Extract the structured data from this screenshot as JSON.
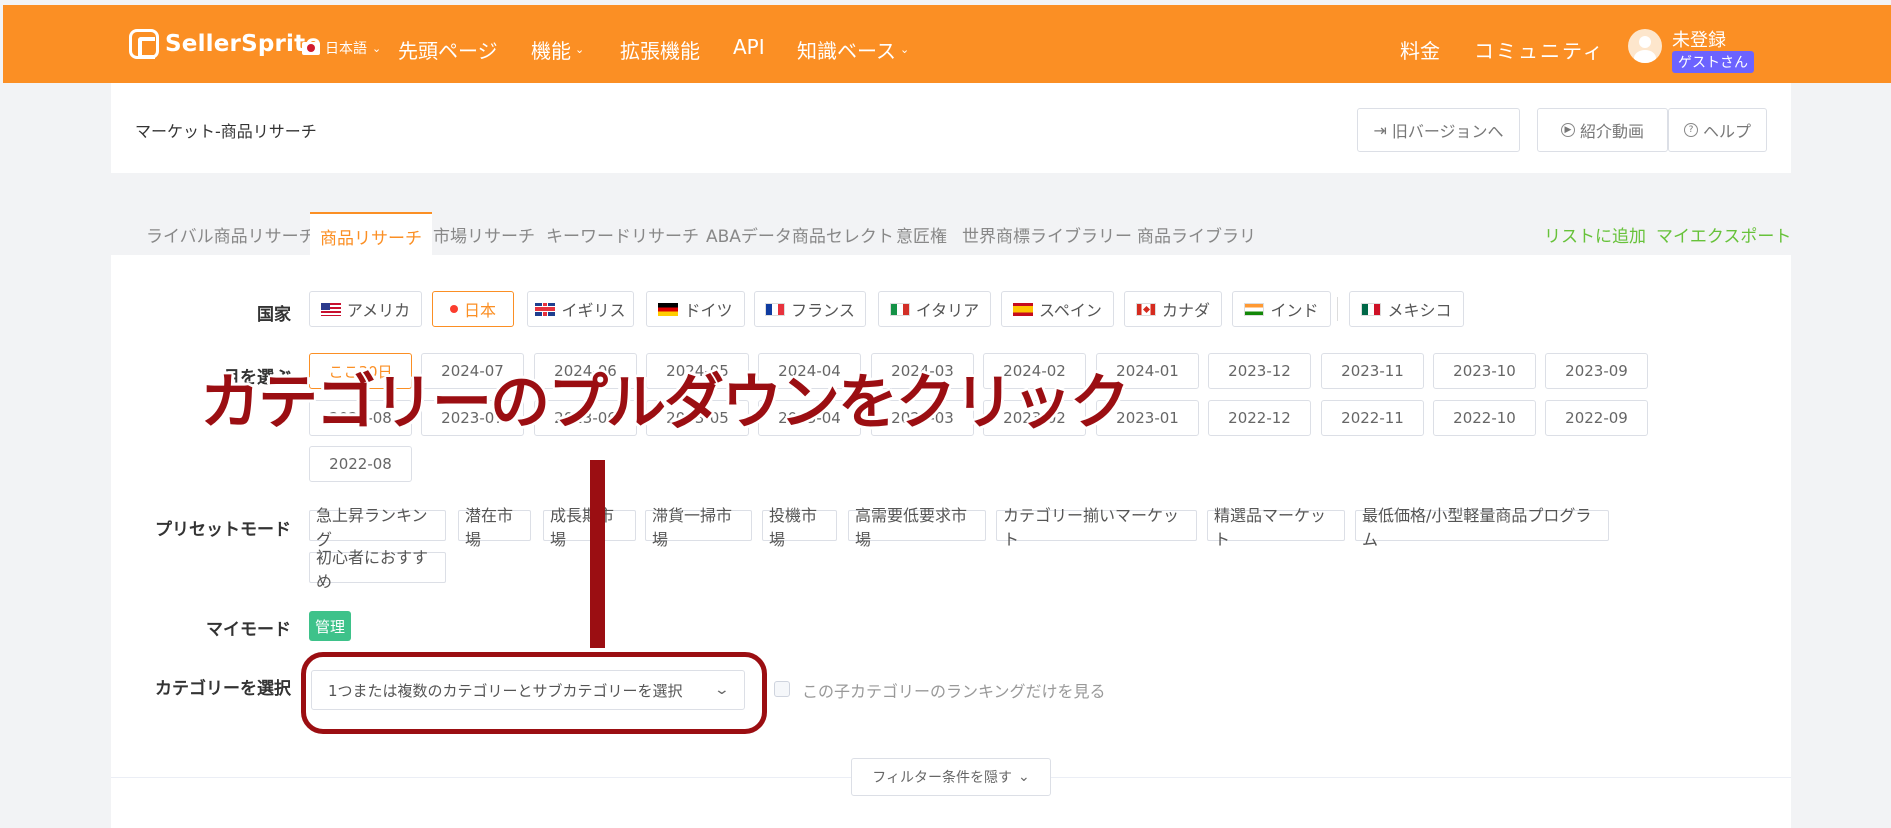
{
  "nav": {
    "brand": "SellerSprite",
    "language": "日本語",
    "items": [
      {
        "label": "先頭ページ",
        "caret": false
      },
      {
        "label": "機能",
        "caret": true
      },
      {
        "label": "拡張機能",
        "caret": false
      },
      {
        "label": "API",
        "caret": false
      },
      {
        "label": "知識ベース",
        "caret": true
      }
    ],
    "right": {
      "pricing": "料金",
      "community": "コミュニティ"
    },
    "user": {
      "name": "未登録",
      "badge": "ゲストさん"
    }
  },
  "header": {
    "title": "マーケット-商品リサーチ",
    "buttons": {
      "old_version": "旧バージョンへ",
      "intro_video": "紹介動画",
      "help": "ヘルプ"
    }
  },
  "tabs": [
    "ライバル商品リサーチ",
    "商品リサーチ",
    "市場リサーチ",
    "キーワードリサーチ",
    "ABAデータ商品セレクト",
    "意匠権",
    "世界商標ライブラリー",
    "商品ライブラリ"
  ],
  "active_tab": "商品リサーチ",
  "tab_actions": {
    "add_list": "リストに追加",
    "my_export": "マイエクスポート"
  },
  "filters": {
    "country_label": "国家",
    "countries": [
      "アメリカ",
      "日本",
      "イギリス",
      "ドイツ",
      "フランス",
      "イタリア",
      "スペイン",
      "カナダ",
      "インド",
      "メキシコ"
    ],
    "selected_country": "日本",
    "month_label": "月を選ぶ",
    "months_row1": [
      "ここ30日",
      "2024-07",
      "2024-06",
      "2024-05",
      "2024-04",
      "2024-03",
      "2024-02",
      "2024-01",
      "2023-12",
      "2023-11",
      "2023-10",
      "2023-09"
    ],
    "months_row2": [
      "2023-08",
      "2023-07",
      "2023-06",
      "2023-05",
      "2023-04",
      "2023-03",
      "2023-02",
      "2023-01",
      "2022-12",
      "2022-11",
      "2022-10",
      "2022-09"
    ],
    "months_row3": [
      "2022-08"
    ],
    "preset_label": "プリセットモード",
    "presets": [
      "急上昇ランキング",
      "潜在市場",
      "成長期市場",
      "滞貨一掃市場",
      "投機市場",
      "高需要低要求市場",
      "カテゴリー揃いマーケット",
      "精選品マーケット",
      "最低価格/小型軽量商品プログラム",
      "初心者におすすめ"
    ],
    "my_mode_label": "マイモード",
    "manage": "管理",
    "category_label": "カテゴリーを選択",
    "category_placeholder": "1つまたは複数のカテゴリーとサブカテゴリーを選択",
    "child_only_label": "この子カテゴリーのランキングだけを見る",
    "hide_filters": "フィルター条件を隠す"
  },
  "annotation": {
    "text": "カテゴリーのプルダウンをクリック",
    "color": "#9b0e12"
  },
  "colors": {
    "accent": "#fb8f24",
    "green": "#67c23a",
    "badge": "#6c63ff",
    "manage": "#3ec28a"
  }
}
